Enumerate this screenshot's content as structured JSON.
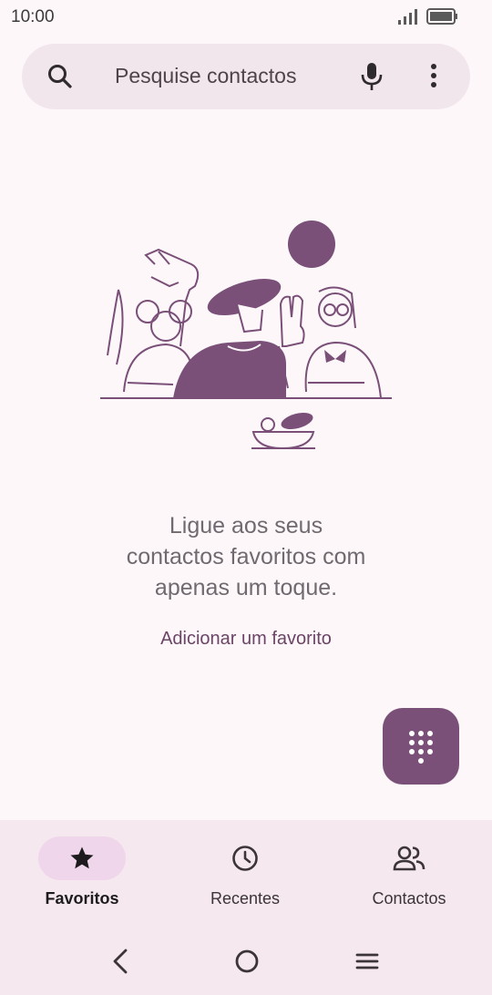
{
  "status": {
    "time": "10:00"
  },
  "search": {
    "placeholder": "Pesquise contactos"
  },
  "empty_state": {
    "line1": "Ligue aos seus",
    "line2": "contactos favoritos com",
    "line3": "apenas um toque.",
    "action": "Adicionar um favorito"
  },
  "nav": {
    "favorites": "Favoritos",
    "recents": "Recentes",
    "contacts": "Contactos"
  },
  "colors": {
    "accent": "#7a4f78",
    "bg": "#fdf7fa",
    "search_bg": "#f1e6ec",
    "nav_bg": "#f5e8ef"
  }
}
